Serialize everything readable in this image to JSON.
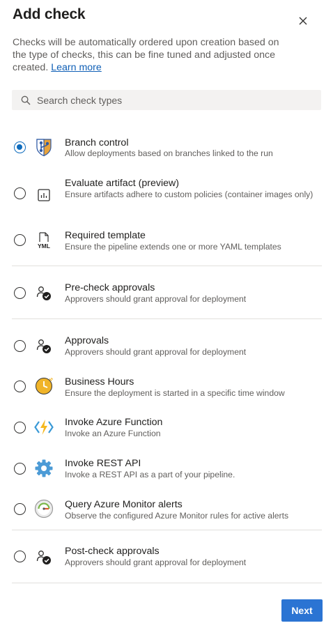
{
  "header": {
    "title": "Add check",
    "close_icon": "close-icon"
  },
  "description": {
    "text": "Checks will be automatically ordered upon creation based on the type of checks, this can be fine tuned and adjusted once created.",
    "link": "Learn more"
  },
  "search": {
    "placeholder": "Search check types",
    "value": ""
  },
  "options": [
    {
      "title": "Branch control",
      "subtitle": "Allow deployments based on branches linked to the run",
      "icon": "branch-shield-icon",
      "selected": true
    },
    {
      "title": "Evaluate artifact (preview)",
      "subtitle": "Ensure artifacts adhere to custom policies (container images only)",
      "icon": "artifact-chart-icon",
      "selected": false
    },
    {
      "title": "Required template",
      "subtitle": "Ensure the pipeline extends one or more YAML templates",
      "icon": "yaml-file-icon",
      "selected": false
    },
    {
      "title": "Pre-check approvals",
      "subtitle": "Approvers should grant approval for deployment",
      "icon": "approval-user-icon",
      "selected": false
    },
    {
      "title": "Approvals",
      "subtitle": "Approvers should grant approval for deployment",
      "icon": "approval-user-icon",
      "selected": false
    },
    {
      "title": "Business Hours",
      "subtitle": "Ensure the deployment is started in a specific time window",
      "icon": "clock-icon",
      "selected": false
    },
    {
      "title": "Invoke Azure Function",
      "subtitle": "Invoke an Azure Function",
      "icon": "azure-function-icon",
      "selected": false
    },
    {
      "title": "Invoke REST API",
      "subtitle": "Invoke a REST API as a part of your pipeline.",
      "icon": "gear-icon",
      "selected": false
    },
    {
      "title": "Query Azure Monitor alerts",
      "subtitle": "Observe the configured Azure Monitor rules for active alerts",
      "icon": "monitor-gauge-icon",
      "selected": false
    },
    {
      "title": "Post-check approvals",
      "subtitle": "Approvers should grant approval for deployment",
      "icon": "approval-user-icon",
      "selected": false
    }
  ],
  "footer": {
    "next_label": "Next"
  },
  "colors": {
    "accent": "#0f6cbd",
    "primary_button": "#2b74d3",
    "link": "#0f5fb6",
    "search_bg": "#f3f2f1",
    "divider": "#e1dfdd"
  }
}
